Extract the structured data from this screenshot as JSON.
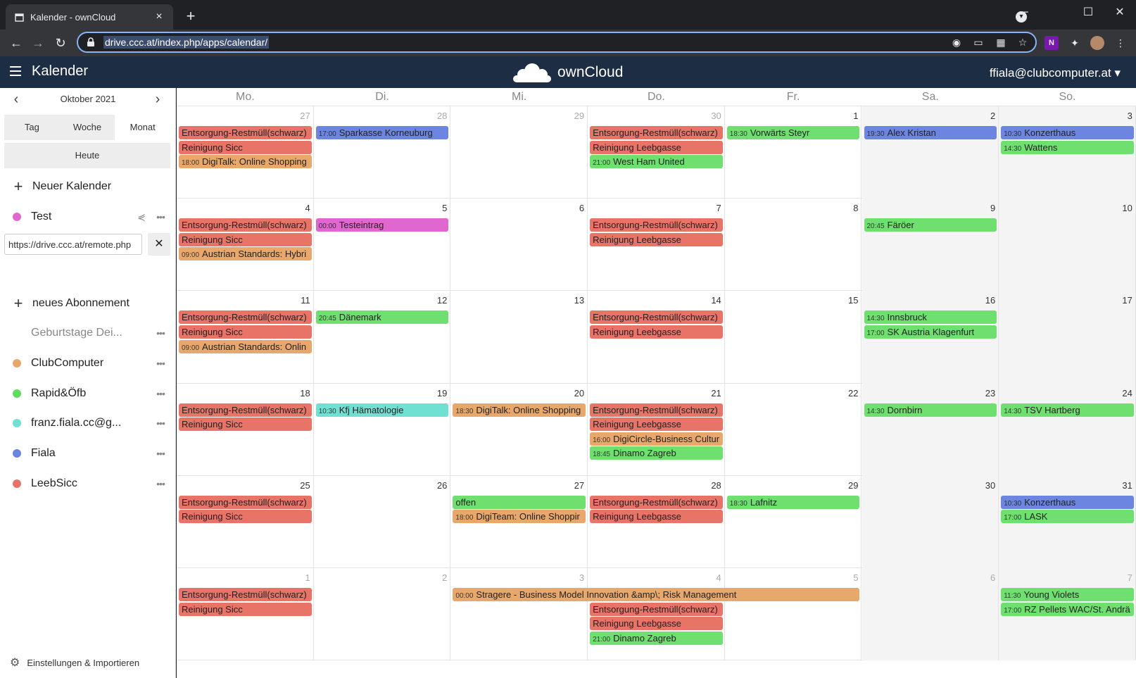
{
  "browser": {
    "tab_title": "Kalender - ownCloud",
    "url": "drive.ccc.at/index.php/apps/calendar/"
  },
  "header": {
    "app_name": "Kalender",
    "brand": "ownCloud",
    "user": "ffiala@clubcomputer.at ▾"
  },
  "sidebar": {
    "month": "Oktober 2021",
    "views": [
      "Tag",
      "Woche",
      "Monat"
    ],
    "active_view": "Monat",
    "today": "Heute",
    "new_calendar": "Neuer Kalender",
    "share_link": "https://drive.ccc.at/remote.php",
    "new_subscription": "neues Abonnement",
    "calendars": [
      {
        "name": "Test",
        "color": "#e066d0"
      },
      {
        "name": "Geburtstage Dei...",
        "color": ""
      },
      {
        "name": "ClubComputer",
        "color": "#e8a86c"
      },
      {
        "name": "Rapid&Öfb",
        "color": "#5fdc5f"
      },
      {
        "name": "franz.fiala.cc@g...",
        "color": "#6fe0d2"
      },
      {
        "name": "Fiala",
        "color": "#6c85e0"
      },
      {
        "name": "LeebSicc",
        "color": "#e87468"
      }
    ],
    "settings": "Einstellungen & Importieren"
  },
  "calendar": {
    "weekdays": [
      "Mo.",
      "Di.",
      "Mi.",
      "Do.",
      "Fr.",
      "Sa.",
      "So."
    ],
    "colors": {
      "red": "#e87468",
      "orange": "#e8a86c",
      "green": "#6fe06f",
      "blue": "#6c85e0",
      "pink": "#e066d0",
      "teal": "#6fe0d2"
    },
    "weeks": [
      [
        {
          "n": "27",
          "other": true,
          "events": [
            {
              "text": "Entsorgung-Restmüll(schwarz)",
              "c": "red"
            },
            {
              "text": "Reinigung Sicc",
              "c": "red"
            },
            {
              "time": "18:00",
              "text": "DigiTalk: Online Shopping",
              "c": "orange"
            }
          ]
        },
        {
          "n": "28",
          "other": true,
          "events": [
            {
              "time": "17:00",
              "text": "Sparkasse Korneuburg",
              "c": "blue"
            }
          ]
        },
        {
          "n": "29",
          "other": true,
          "events": []
        },
        {
          "n": "30",
          "other": true,
          "events": [
            {
              "text": "Entsorgung-Restmüll(schwarz)",
              "c": "red"
            },
            {
              "text": "Reinigung Leebgasse",
              "c": "red"
            },
            {
              "time": "21:00",
              "text": "West Ham United",
              "c": "green"
            }
          ]
        },
        {
          "n": "1",
          "events": [
            {
              "time": "18:30",
              "text": "Vorwärts Steyr",
              "c": "green"
            }
          ]
        },
        {
          "n": "2",
          "events": [
            {
              "time": "19:30",
              "text": "Alex Kristan",
              "c": "blue"
            }
          ]
        },
        {
          "n": "3",
          "events": [
            {
              "time": "10:30",
              "text": "Konzerthaus",
              "c": "blue"
            },
            {
              "time": "14:30",
              "text": "Wattens",
              "c": "green"
            }
          ]
        }
      ],
      [
        {
          "n": "4",
          "events": [
            {
              "text": "Entsorgung-Restmüll(schwarz)",
              "c": "red"
            },
            {
              "text": "Reinigung Sicc",
              "c": "red"
            },
            {
              "time": "09:00",
              "text": "Austrian Standards: Hybri",
              "c": "orange"
            }
          ]
        },
        {
          "n": "5",
          "events": [
            {
              "time": "00:00",
              "text": "Testeintrag",
              "c": "pink"
            }
          ]
        },
        {
          "n": "6",
          "events": []
        },
        {
          "n": "7",
          "events": [
            {
              "text": "Entsorgung-Restmüll(schwarz)",
              "c": "red"
            },
            {
              "text": "Reinigung Leebgasse",
              "c": "red"
            }
          ]
        },
        {
          "n": "8",
          "events": []
        },
        {
          "n": "9",
          "events": [
            {
              "time": "20:45",
              "text": "Färöer",
              "c": "green"
            }
          ]
        },
        {
          "n": "10",
          "events": []
        }
      ],
      [
        {
          "n": "11",
          "events": [
            {
              "text": "Entsorgung-Restmüll(schwarz)",
              "c": "red"
            },
            {
              "text": "Reinigung Sicc",
              "c": "red"
            },
            {
              "time": "09:00",
              "text": "Austrian Standards: Onlin",
              "c": "orange"
            }
          ]
        },
        {
          "n": "12",
          "events": [
            {
              "time": "20:45",
              "text": "Dänemark",
              "c": "green"
            }
          ]
        },
        {
          "n": "13",
          "events": []
        },
        {
          "n": "14",
          "events": [
            {
              "text": "Entsorgung-Restmüll(schwarz)",
              "c": "red"
            },
            {
              "text": "Reinigung Leebgasse",
              "c": "red"
            }
          ]
        },
        {
          "n": "15",
          "events": []
        },
        {
          "n": "16",
          "events": [
            {
              "time": "14:30",
              "text": "Innsbruck",
              "c": "green"
            },
            {
              "time": "17:00",
              "text": "SK Austria Klagenfurt",
              "c": "green"
            }
          ]
        },
        {
          "n": "17",
          "events": []
        }
      ],
      [
        {
          "n": "18",
          "events": [
            {
              "text": "Entsorgung-Restmüll(schwarz)",
              "c": "red"
            },
            {
              "text": "Reinigung Sicc",
              "c": "red"
            }
          ]
        },
        {
          "n": "19",
          "events": [
            {
              "time": "10:30",
              "text": "Kfj Hämatologie",
              "c": "teal"
            }
          ]
        },
        {
          "n": "20",
          "events": [
            {
              "time": "18:30",
              "text": "DigiTalk: Online Shopping",
              "c": "orange"
            }
          ]
        },
        {
          "n": "21",
          "events": [
            {
              "text": "Entsorgung-Restmüll(schwarz)",
              "c": "red"
            },
            {
              "text": "Reinigung Leebgasse",
              "c": "red"
            },
            {
              "time": "16:00",
              "text": "DigiCircle-Business Cultur",
              "c": "orange"
            },
            {
              "time": "18:45",
              "text": "Dinamo Zagreb",
              "c": "green"
            }
          ]
        },
        {
          "n": "22",
          "events": []
        },
        {
          "n": "23",
          "events": [
            {
              "time": "14:30",
              "text": "Dornbirn",
              "c": "green"
            }
          ]
        },
        {
          "n": "24",
          "events": [
            {
              "time": "14:30",
              "text": "TSV Hartberg",
              "c": "green"
            }
          ]
        }
      ],
      [
        {
          "n": "25",
          "events": [
            {
              "text": "Entsorgung-Restmüll(schwarz)",
              "c": "red"
            },
            {
              "text": "Reinigung Sicc",
              "c": "red"
            }
          ]
        },
        {
          "n": "26",
          "events": []
        },
        {
          "n": "27",
          "events": [
            {
              "text": "offen",
              "c": "green"
            },
            {
              "time": "18:00",
              "text": "DigiTeam: Online Shoppir",
              "c": "orange"
            }
          ]
        },
        {
          "n": "28",
          "events": [
            {
              "text": "Entsorgung-Restmüll(schwarz)",
              "c": "red"
            },
            {
              "text": "Reinigung Leebgasse",
              "c": "red"
            }
          ]
        },
        {
          "n": "29",
          "events": [
            {
              "time": "18:30",
              "text": "Lafnitz",
              "c": "green"
            }
          ]
        },
        {
          "n": "30",
          "events": []
        },
        {
          "n": "31",
          "events": [
            {
              "time": "10:30",
              "text": "Konzerthaus",
              "c": "blue"
            },
            {
              "time": "17:00",
              "text": "LASK",
              "c": "green"
            }
          ]
        }
      ],
      [
        {
          "n": "1",
          "other": true,
          "events": [
            {
              "text": "Entsorgung-Restmüll(schwarz)",
              "c": "red"
            },
            {
              "text": "Reinigung Sicc",
              "c": "red"
            }
          ]
        },
        {
          "n": "2",
          "other": true,
          "events": []
        },
        {
          "n": "3",
          "other": true,
          "events": [
            {
              "time": "00:00",
              "text": "Stragere - Business Model Innovation &amp\\; Risk Management",
              "c": "orange",
              "span": 3
            }
          ]
        },
        {
          "n": "4",
          "other": true,
          "events": [
            {
              "skip": true
            },
            {
              "text": "Entsorgung-Restmüll(schwarz)",
              "c": "red"
            },
            {
              "text": "Reinigung Leebgasse",
              "c": "red"
            },
            {
              "time": "21:00",
              "text": "Dinamo Zagreb",
              "c": "green"
            }
          ]
        },
        {
          "n": "5",
          "other": true,
          "events": []
        },
        {
          "n": "6",
          "other": true,
          "events": []
        },
        {
          "n": "7",
          "other": true,
          "events": [
            {
              "time": "11:30",
              "text": "Young Violets",
              "c": "green"
            },
            {
              "time": "17:00",
              "text": "RZ Pellets WAC/St. Andrä",
              "c": "green"
            }
          ]
        }
      ]
    ]
  }
}
